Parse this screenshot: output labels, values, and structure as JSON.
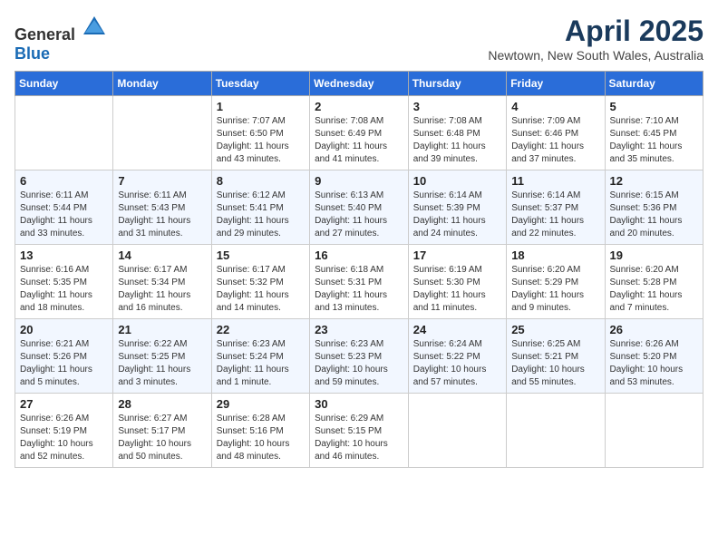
{
  "header": {
    "logo_general": "General",
    "logo_blue": "Blue",
    "month": "April 2025",
    "location": "Newtown, New South Wales, Australia"
  },
  "days_of_week": [
    "Sunday",
    "Monday",
    "Tuesday",
    "Wednesday",
    "Thursday",
    "Friday",
    "Saturday"
  ],
  "weeks": [
    [
      {
        "day": "",
        "info": ""
      },
      {
        "day": "",
        "info": ""
      },
      {
        "day": "1",
        "info": "Sunrise: 7:07 AM\nSunset: 6:50 PM\nDaylight: 11 hours and 43 minutes."
      },
      {
        "day": "2",
        "info": "Sunrise: 7:08 AM\nSunset: 6:49 PM\nDaylight: 11 hours and 41 minutes."
      },
      {
        "day": "3",
        "info": "Sunrise: 7:08 AM\nSunset: 6:48 PM\nDaylight: 11 hours and 39 minutes."
      },
      {
        "day": "4",
        "info": "Sunrise: 7:09 AM\nSunset: 6:46 PM\nDaylight: 11 hours and 37 minutes."
      },
      {
        "day": "5",
        "info": "Sunrise: 7:10 AM\nSunset: 6:45 PM\nDaylight: 11 hours and 35 minutes."
      }
    ],
    [
      {
        "day": "6",
        "info": "Sunrise: 6:11 AM\nSunset: 5:44 PM\nDaylight: 11 hours and 33 minutes."
      },
      {
        "day": "7",
        "info": "Sunrise: 6:11 AM\nSunset: 5:43 PM\nDaylight: 11 hours and 31 minutes."
      },
      {
        "day": "8",
        "info": "Sunrise: 6:12 AM\nSunset: 5:41 PM\nDaylight: 11 hours and 29 minutes."
      },
      {
        "day": "9",
        "info": "Sunrise: 6:13 AM\nSunset: 5:40 PM\nDaylight: 11 hours and 27 minutes."
      },
      {
        "day": "10",
        "info": "Sunrise: 6:14 AM\nSunset: 5:39 PM\nDaylight: 11 hours and 24 minutes."
      },
      {
        "day": "11",
        "info": "Sunrise: 6:14 AM\nSunset: 5:37 PM\nDaylight: 11 hours and 22 minutes."
      },
      {
        "day": "12",
        "info": "Sunrise: 6:15 AM\nSunset: 5:36 PM\nDaylight: 11 hours and 20 minutes."
      }
    ],
    [
      {
        "day": "13",
        "info": "Sunrise: 6:16 AM\nSunset: 5:35 PM\nDaylight: 11 hours and 18 minutes."
      },
      {
        "day": "14",
        "info": "Sunrise: 6:17 AM\nSunset: 5:34 PM\nDaylight: 11 hours and 16 minutes."
      },
      {
        "day": "15",
        "info": "Sunrise: 6:17 AM\nSunset: 5:32 PM\nDaylight: 11 hours and 14 minutes."
      },
      {
        "day": "16",
        "info": "Sunrise: 6:18 AM\nSunset: 5:31 PM\nDaylight: 11 hours and 13 minutes."
      },
      {
        "day": "17",
        "info": "Sunrise: 6:19 AM\nSunset: 5:30 PM\nDaylight: 11 hours and 11 minutes."
      },
      {
        "day": "18",
        "info": "Sunrise: 6:20 AM\nSunset: 5:29 PM\nDaylight: 11 hours and 9 minutes."
      },
      {
        "day": "19",
        "info": "Sunrise: 6:20 AM\nSunset: 5:28 PM\nDaylight: 11 hours and 7 minutes."
      }
    ],
    [
      {
        "day": "20",
        "info": "Sunrise: 6:21 AM\nSunset: 5:26 PM\nDaylight: 11 hours and 5 minutes."
      },
      {
        "day": "21",
        "info": "Sunrise: 6:22 AM\nSunset: 5:25 PM\nDaylight: 11 hours and 3 minutes."
      },
      {
        "day": "22",
        "info": "Sunrise: 6:23 AM\nSunset: 5:24 PM\nDaylight: 11 hours and 1 minute."
      },
      {
        "day": "23",
        "info": "Sunrise: 6:23 AM\nSunset: 5:23 PM\nDaylight: 10 hours and 59 minutes."
      },
      {
        "day": "24",
        "info": "Sunrise: 6:24 AM\nSunset: 5:22 PM\nDaylight: 10 hours and 57 minutes."
      },
      {
        "day": "25",
        "info": "Sunrise: 6:25 AM\nSunset: 5:21 PM\nDaylight: 10 hours and 55 minutes."
      },
      {
        "day": "26",
        "info": "Sunrise: 6:26 AM\nSunset: 5:20 PM\nDaylight: 10 hours and 53 minutes."
      }
    ],
    [
      {
        "day": "27",
        "info": "Sunrise: 6:26 AM\nSunset: 5:19 PM\nDaylight: 10 hours and 52 minutes."
      },
      {
        "day": "28",
        "info": "Sunrise: 6:27 AM\nSunset: 5:17 PM\nDaylight: 10 hours and 50 minutes."
      },
      {
        "day": "29",
        "info": "Sunrise: 6:28 AM\nSunset: 5:16 PM\nDaylight: 10 hours and 48 minutes."
      },
      {
        "day": "30",
        "info": "Sunrise: 6:29 AM\nSunset: 5:15 PM\nDaylight: 10 hours and 46 minutes."
      },
      {
        "day": "",
        "info": ""
      },
      {
        "day": "",
        "info": ""
      },
      {
        "day": "",
        "info": ""
      }
    ]
  ]
}
